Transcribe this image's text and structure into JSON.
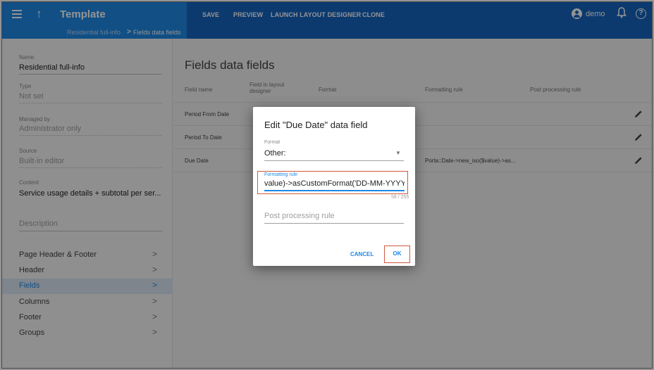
{
  "appbar": {
    "title": "Template",
    "up_glyph": "↑",
    "actions": [
      "SAVE",
      "PREVIEW",
      "LAUNCH LAYOUT DESIGNER",
      "CLONE"
    ],
    "user": "demo",
    "bell_glyph": "🔔",
    "help_glyph": "?"
  },
  "breadcrumb": {
    "parent": "Residential full-info",
    "separator": ">",
    "current": "Fields data fields"
  },
  "sidebar": {
    "name_label": "Name",
    "name_value": "Residential full-info",
    "type_label": "Type",
    "type_value": "Not set",
    "managed_label": "Managed by",
    "managed_value": "Administrator only",
    "source_label": "Source",
    "source_value": "Built-in editor",
    "content_label": "Content",
    "content_value": "Service usage details + subtotal per ser...",
    "description_placeholder": "Description",
    "chevron": ">",
    "nav": [
      {
        "label": "Page Header & Footer",
        "active": false
      },
      {
        "label": "Header",
        "active": false
      },
      {
        "label": "Fields",
        "active": true
      },
      {
        "label": "Columns",
        "active": false
      },
      {
        "label": "Footer",
        "active": false
      },
      {
        "label": "Groups",
        "active": false
      }
    ]
  },
  "main": {
    "title": "Fields data fields",
    "columns": [
      "Field name",
      "Field in layout designer",
      "Format",
      "Formatting rule",
      "Post processing rule"
    ],
    "rows": [
      {
        "name": "Period From Date",
        "rule": ""
      },
      {
        "name": "Period To Date",
        "rule": ""
      },
      {
        "name": "Due Date",
        "rule": "Porta::Date->new_iso($value)->as..."
      }
    ]
  },
  "dialog": {
    "title": "Edit \"Due Date\" data field",
    "format_label": "Format",
    "format_value": "Other:",
    "caret": "▼",
    "rule_label": "Formatting rule",
    "rule_value": "value)->asCustomFormat('DD-MM-YYYY')",
    "counter": "58 / 255",
    "post_placeholder": "Post processing rule",
    "cancel_label": "CANCEL",
    "ok_label": "OK"
  },
  "colors": {
    "primary": "#1e88e5",
    "primary_dark": "#1565c0",
    "highlight": "#d0593e"
  },
  "icons": [
    "menu-icon",
    "arrow-up-icon",
    "account-icon",
    "bell-icon",
    "help-icon",
    "pencil-icon",
    "chevron-right-icon",
    "dropdown-caret-icon"
  ]
}
